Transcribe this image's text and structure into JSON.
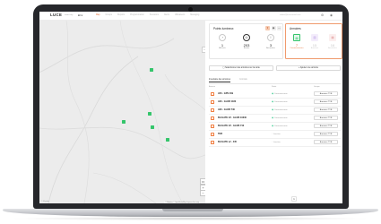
{
  "app": {
    "logo": "LUCE",
    "logo_sub": "smart city",
    "language": "EN"
  },
  "nav": [
    "Map",
    "Groups",
    "Reports",
    "Programmation",
    "Scenarios",
    "Alerts",
    "Utilisateurs",
    "Managing"
  ],
  "user": {
    "email": "admin@lucecontrol.com"
  },
  "colors": {
    "accent": "#e8733a",
    "marker": "#35c56b",
    "online": "#3cc98f"
  },
  "map": {
    "attribution": "© Mapbox © OpenStreetMap  Improve this map",
    "credit": "© Mapbox",
    "zoom_in": "+",
    "zoom_out": "−",
    "collapse": "‹"
  },
  "points_card": {
    "title": "Points lumineux",
    "stats": [
      {
        "value": "1",
        "label": "Allumés",
        "icon": "bulb-icon",
        "glyph": "◔"
      },
      {
        "value": "203",
        "label": "Éteints",
        "icon": "power-icon",
        "glyph": "⏻"
      },
      {
        "value": "3",
        "label": "Anomalies",
        "icon": "alert-icon",
        "glyph": "!"
      }
    ]
  },
  "armoires_card": {
    "title": "Armoires",
    "stats": [
      {
        "value": "7",
        "label": "Communicantes",
        "icon": "wifi-icon",
        "glyph": "▤"
      },
      {
        "value": "15",
        "label": "Armoires",
        "icon": "cabinet-icon",
        "glyph": "▥"
      },
      {
        "value": "16",
        "label": "Anomalies",
        "icon": "alert-icon",
        "glyph": "▦"
      }
    ]
  },
  "actions": {
    "select_label": "Sélectionner des armoires sur la carte",
    "add_label": "+ Ajouter une armoire"
  },
  "tabs": [
    "Inventaire des armoires",
    "Contrats"
  ],
  "table": {
    "headers": [
      "Armoire",
      "Statut",
      "Groupe"
    ],
    "rows": [
      {
        "name": "A50 - GPS 439",
        "status": "Communicante",
        "group": "Armoires TVB"
      },
      {
        "name": "A30 - GLOB 1180",
        "status": "Communicante",
        "group": "Armoires TVB"
      },
      {
        "name": "A30 - GLOB 740",
        "status": "Communicante",
        "group": "Armoires TVB"
      },
      {
        "name": "BH GATE V2 - GLOB 10340",
        "status": "Communicante",
        "group": "Armoires TVB"
      },
      {
        "name": "BH GATE V2 - GLOB 710",
        "status": "Communicante",
        "group": "Armoires TVB"
      },
      {
        "name": "TEB",
        "status": "Inactive",
        "group": "Armoires TVB"
      },
      {
        "name": "BH GATE v2 - 445",
        "status": "Inactive",
        "group": "Armoires TVB"
      }
    ]
  },
  "pagination": {
    "current": "1"
  }
}
